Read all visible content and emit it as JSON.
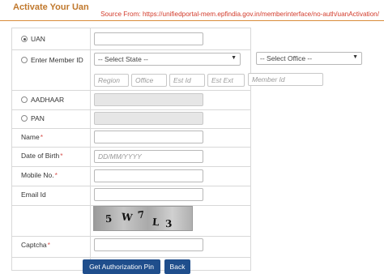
{
  "header": {
    "title": "Activate Your Uan",
    "source": "Source From: https://unifiedportal-mem.epfindia.gov.in/memberinterface/no-auth/uanActivation/"
  },
  "form": {
    "uan_label": "UAN",
    "member_id_label": "Enter Member ID",
    "state_select": "-- Select State --",
    "office_select": "-- Select Office --",
    "member_id_parts": [
      "Region",
      "Office",
      "Est Id",
      "Est Ext",
      "Member Id"
    ],
    "aadhaar_label": "AADHAAR",
    "pan_label": "PAN",
    "name_label": "Name",
    "dob_label": "Date of Birth",
    "dob_placeholder": "DD/MM/YYYY",
    "mobile_label": "Mobile No.",
    "email_label": "Email Id",
    "captcha_label": "Captcha",
    "required_mark": "*",
    "captcha_chars": [
      "5",
      "W",
      "7",
      "L",
      "3"
    ]
  },
  "buttons": {
    "get_pin": "Get Authorization Pin",
    "back": "Back"
  }
}
